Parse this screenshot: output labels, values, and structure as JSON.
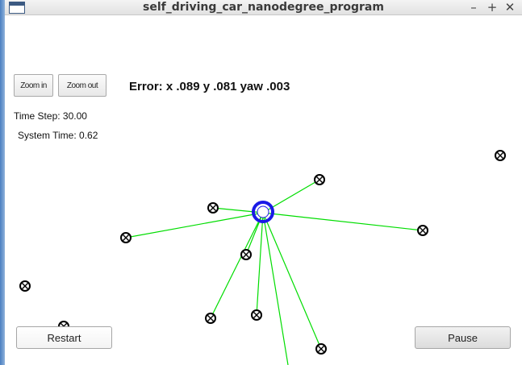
{
  "window": {
    "title": "self_driving_car_nanodegree_program",
    "controls": {
      "minimize": "–",
      "maximize": "+",
      "close": "✕"
    }
  },
  "zoom": {
    "in_label": "Zoom in",
    "out_label": "Zoom out"
  },
  "status": {
    "error": "Error: x .089 y .081 yaw .003",
    "time_step": "Time Step: 30.00",
    "system_time": "System Time: 0.62"
  },
  "buttons": {
    "restart": "Restart",
    "pause": "Pause"
  },
  "colors": {
    "observation_line": "#00dd00",
    "vehicle": "#1a1ae6",
    "landmark": "#000000",
    "titlebar_accent": "#4a7fc1"
  }
}
